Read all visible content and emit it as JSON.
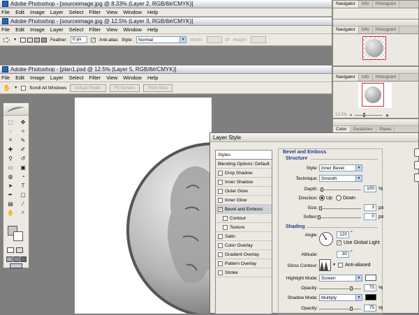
{
  "windows": {
    "win1_title": "Adobe Photoshop - [sourceimage.jpg @ 8.33% (Layer 2, RGB/8#/CMYK)]",
    "win2_title": "Adobe Photoshop - [sourceimage.jpg @ 12.5% (Layer 3, RGB/8#/CMYK)]",
    "main_title": "Adobe Photoshop - [plan1.psd @ 12.5% (Layer 5, RGB/8#/CMYK)]"
  },
  "menu": [
    "File",
    "Edit",
    "Image",
    "Layer",
    "Select",
    "Filter",
    "View",
    "Window",
    "Help"
  ],
  "marquee_options": {
    "feather_label": "Feather:",
    "feather_value": "0 px",
    "antialias_label": "Anti-alias",
    "style_label": "Style:",
    "style_value": "Normal",
    "width_label": "Width:",
    "height_label": "Height:"
  },
  "hand_options": {
    "scroll_all_label": "Scroll All Windows",
    "actual_pixels": "Actual Pixels",
    "fit_screen": "Fit Screen",
    "print_size": "Print Size"
  },
  "navigator_tabs": [
    "Navigator",
    "Info",
    "Histogram"
  ],
  "zoom_readout": "12.5%",
  "color_tabs": [
    "Color",
    "Swatches",
    "Styles"
  ],
  "dialog": {
    "title": "Layer Style",
    "styles_header": "Styles",
    "style_items": [
      {
        "label": "Blending Options: Default",
        "checkbox": false,
        "checked": false,
        "indent": false,
        "selected": false
      },
      {
        "label": "Drop Shadow",
        "checkbox": true,
        "checked": false,
        "indent": false,
        "selected": false
      },
      {
        "label": "Inner Shadow",
        "checkbox": true,
        "checked": false,
        "indent": false,
        "selected": false
      },
      {
        "label": "Outer Glow",
        "checkbox": true,
        "checked": false,
        "indent": false,
        "selected": false
      },
      {
        "label": "Inner Glow",
        "checkbox": true,
        "checked": false,
        "indent": false,
        "selected": false
      },
      {
        "label": "Bevel and Emboss",
        "checkbox": true,
        "checked": true,
        "indent": false,
        "selected": true
      },
      {
        "label": "Contour",
        "checkbox": true,
        "checked": false,
        "indent": true,
        "selected": false
      },
      {
        "label": "Texture",
        "checkbox": true,
        "checked": false,
        "indent": true,
        "selected": false
      },
      {
        "label": "Satin",
        "checkbox": true,
        "checked": false,
        "indent": false,
        "selected": false
      },
      {
        "label": "Color Overlay",
        "checkbox": true,
        "checked": false,
        "indent": false,
        "selected": false
      },
      {
        "label": "Gradient Overlay",
        "checkbox": true,
        "checked": false,
        "indent": false,
        "selected": false
      },
      {
        "label": "Pattern Overlay",
        "checkbox": true,
        "checked": false,
        "indent": false,
        "selected": false
      },
      {
        "label": "Stroke",
        "checkbox": true,
        "checked": false,
        "indent": false,
        "selected": false
      }
    ],
    "bevel": {
      "group_title": "Bevel and Emboss",
      "structure_title": "Structure",
      "style_label": "Style:",
      "style_value": "Inner Bevel",
      "technique_label": "Technique:",
      "technique_value": "Smooth",
      "depth_label": "Depth:",
      "depth_value": "100",
      "depth_unit": "%",
      "direction_label": "Direction:",
      "dir_up": "Up",
      "dir_down": "Down",
      "size_label": "Size:",
      "size_value": "3",
      "size_unit": "px",
      "soften_label": "Soften:",
      "soften_value": "0",
      "soften_unit": "px"
    },
    "shading": {
      "title": "Shading",
      "angle_label": "Angle:",
      "angle_value": "120",
      "global_light_label": "Use Global Light",
      "altitude_label": "Altitude:",
      "altitude_value": "30",
      "gloss_label": "Gloss Contour:",
      "antialiased_label": "Anti-aliased",
      "highlight_label": "Highlight Mode:",
      "highlight_value": "Screen",
      "highlight_color": "#ffffff",
      "opacity_label": "Opacity:",
      "highlight_opacity": "75",
      "shadow_label": "Shadow Mode:",
      "shadow_value": "Multiply",
      "shadow_color": "#000000",
      "shadow_opacity": "75",
      "pct": "%"
    }
  },
  "colors": {
    "workspace": "#7f7f7f",
    "dialog_accent": "#1d3e8c",
    "panel_bg": "#ece9e2"
  }
}
